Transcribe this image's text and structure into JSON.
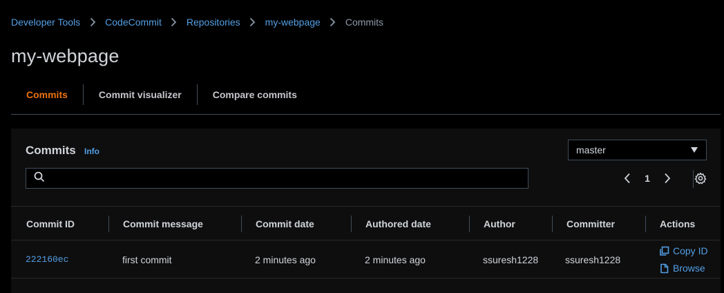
{
  "breadcrumb": {
    "items": [
      {
        "label": "Developer Tools"
      },
      {
        "label": "CodeCommit"
      },
      {
        "label": "Repositories"
      },
      {
        "label": "my-webpage"
      },
      {
        "label": "Commits"
      }
    ]
  },
  "page": {
    "title": "my-webpage"
  },
  "tabs": [
    {
      "label": "Commits",
      "active": true
    },
    {
      "label": "Commit visualizer",
      "active": false
    },
    {
      "label": "Compare commits",
      "active": false
    }
  ],
  "commits_panel": {
    "title": "Commits",
    "info_label": "Info",
    "branch_selected": "master",
    "search": {
      "value": "",
      "placeholder": ""
    },
    "pagination": {
      "current_page": "1"
    }
  },
  "table": {
    "columns": [
      "Commit ID",
      "Commit message",
      "Commit date",
      "Authored date",
      "Author",
      "Committer",
      "Actions"
    ],
    "rows": [
      {
        "commit_id": "222160ec",
        "message": "first commit",
        "commit_date": "2 minutes ago",
        "authored_date": "2 minutes ago",
        "author": "ssuresh1228",
        "committer": "ssuresh1228",
        "actions": {
          "copy_label": "Copy ID",
          "browse_label": "Browse"
        }
      }
    ]
  },
  "colors": {
    "background": "#000000",
    "link": "#539fe5",
    "active_tab": "#ec7211",
    "text": "#d1d5db"
  },
  "icons": [
    "chevron-right-icon",
    "search-icon",
    "caret-down-icon",
    "chevron-left-icon",
    "settings-icon",
    "copy-icon",
    "file-icon"
  ]
}
